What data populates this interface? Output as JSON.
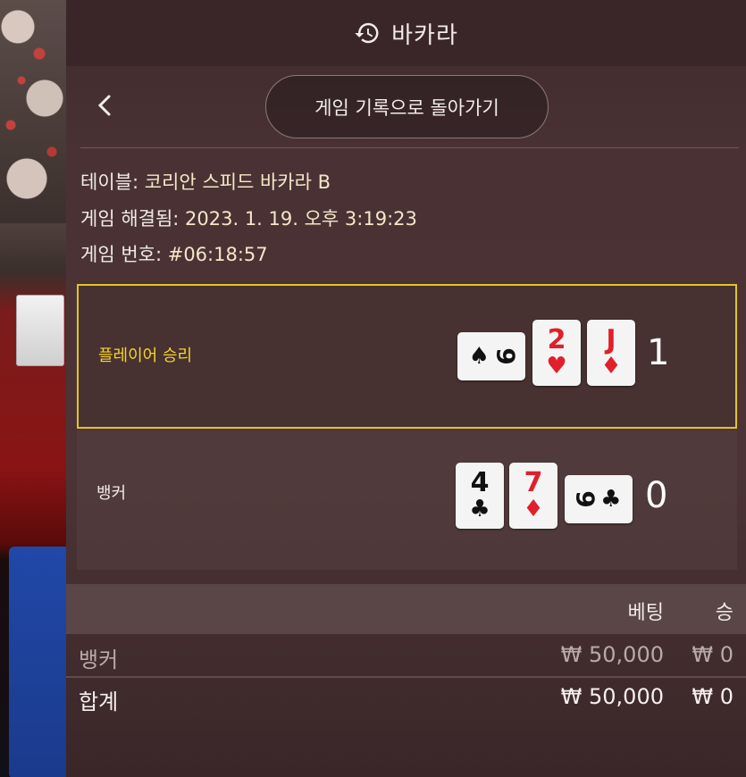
{
  "header": {
    "title": "바카라",
    "icon": "history-icon"
  },
  "nav": {
    "back_icon": "chevron-left-icon",
    "return_label": "게임 기록으로 돌아가기"
  },
  "info": {
    "table_label": "테이블: ",
    "table_value": "코리안 스피드 바카라 B",
    "resolved_label": "게임 해결됨: ",
    "resolved_value": "2023. 1. 19. 오후 3:19:23",
    "round_label": "게임 번호: ",
    "round_value": "#06:18:57"
  },
  "hands": {
    "player": {
      "label": "플레이어 승리",
      "score": "1",
      "cards": [
        {
          "rank": "9",
          "suit": "♠",
          "color": "black",
          "orientation": "side"
        },
        {
          "rank": "2",
          "suit": "♥",
          "color": "red",
          "orientation": "up"
        },
        {
          "rank": "J",
          "suit": "♦",
          "color": "red",
          "orientation": "up"
        }
      ]
    },
    "banker": {
      "label": "뱅커",
      "score": "0",
      "cards": [
        {
          "rank": "4",
          "suit": "♣",
          "color": "black",
          "orientation": "up"
        },
        {
          "rank": "7",
          "suit": "♦",
          "color": "red",
          "orientation": "up"
        },
        {
          "rank": "9",
          "suit": "♣",
          "color": "black",
          "orientation": "side"
        }
      ]
    }
  },
  "bets": {
    "header_bet": "베팅",
    "header_win": "승",
    "rows": [
      {
        "name": "뱅커",
        "bet": "₩ 50,000",
        "win": "₩ 0"
      }
    ],
    "total": {
      "name": "합계",
      "bet": "₩ 50,000",
      "win": "₩ 0"
    }
  },
  "colors": {
    "winner_border": "#e3c42a",
    "winner_label": "#f5d42c",
    "red_suit": "#e0202a",
    "black_suit": "#111111"
  }
}
